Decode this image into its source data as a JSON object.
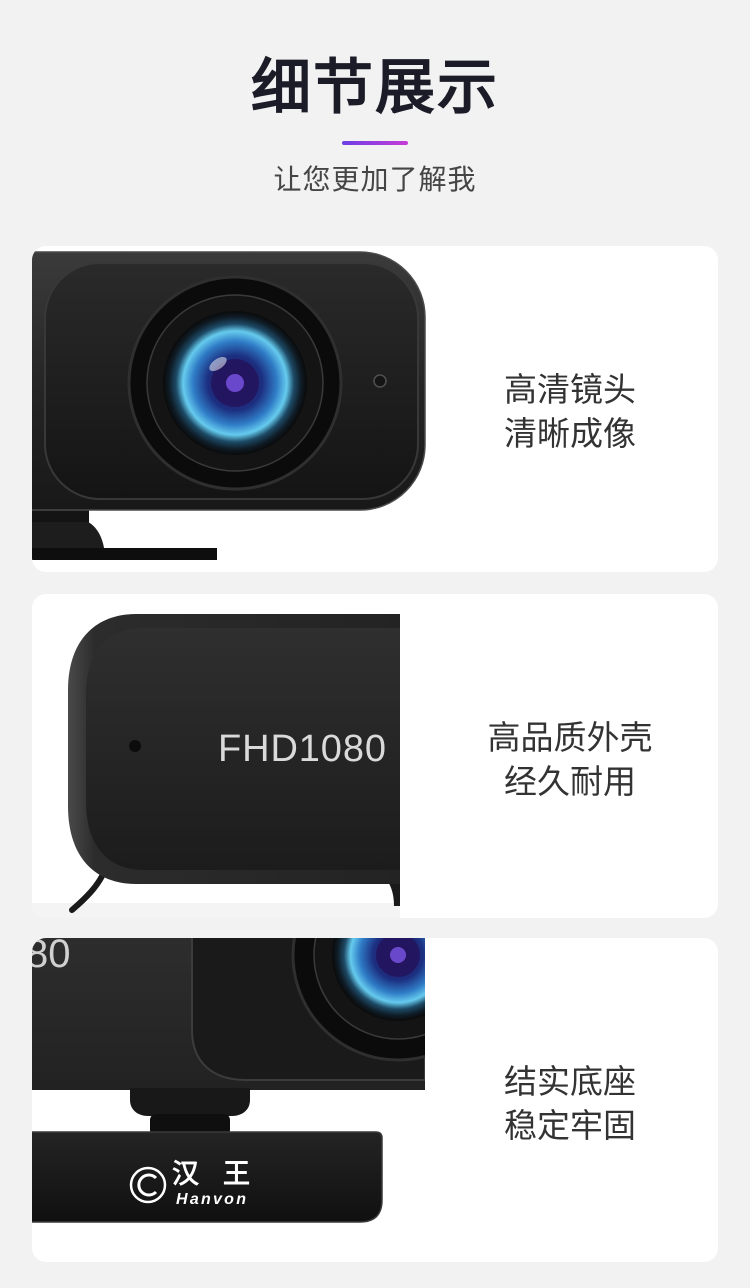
{
  "header": {
    "title": "细节展示",
    "subtitle": "让您更加了解我"
  },
  "colors": {
    "background": "#f2f2f2",
    "card": "#ffffff",
    "accent_start": "#6b3fe6",
    "accent_end": "#c73bd6",
    "title": "#1c1c28",
    "text": "#333333"
  },
  "features": [
    {
      "lines": [
        "高清镜头",
        "清晰成像"
      ]
    },
    {
      "lines": [
        "高品质外壳",
        "经久耐用"
      ],
      "print": "FHD1080"
    },
    {
      "lines": [
        "结实底座",
        "稳定牢固"
      ],
      "print": "80",
      "logo": {
        "name": "汉王",
        "latin": "Hanvon"
      }
    }
  ]
}
